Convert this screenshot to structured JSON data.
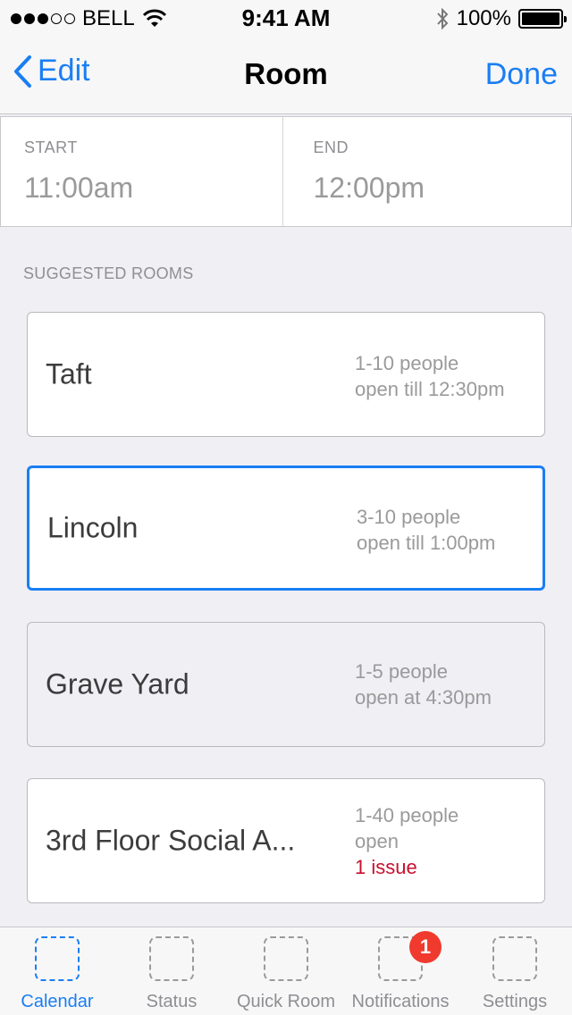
{
  "status_bar": {
    "carrier": "BELL",
    "time": "9:41 AM",
    "battery": "100%",
    "signal_bars_filled": 3,
    "signal_bars_total": 5,
    "icons": [
      "signal-dots-icon",
      "wifi-icon",
      "bluetooth-icon",
      "battery-icon"
    ]
  },
  "nav": {
    "back_label": "Edit",
    "title": "Room",
    "done_label": "Done"
  },
  "time": {
    "start_label": "START",
    "start_value": "11:00am",
    "end_label": "END",
    "end_value": "12:00pm"
  },
  "section_header": "SUGGESTED ROOMS",
  "rooms": [
    {
      "name": "Taft",
      "capacity": "1-10 people",
      "availability": "open till 12:30pm",
      "issue": ""
    },
    {
      "name": "Lincoln",
      "capacity": "3-10 people",
      "availability": "open till 1:00pm",
      "issue": ""
    },
    {
      "name": "Grave Yard",
      "capacity": "1-5 people",
      "availability": "open at 4:30pm",
      "issue": ""
    },
    {
      "name": "3rd Floor Social A...",
      "capacity": "1-40 people",
      "availability": "open",
      "issue": "1 issue"
    }
  ],
  "tabs": [
    {
      "label": "Calendar"
    },
    {
      "label": "Status"
    },
    {
      "label": "Quick Room"
    },
    {
      "label": "Notifications",
      "badge": "1"
    },
    {
      "label": "Settings"
    }
  ],
  "colors": {
    "accent": "#1a7ef3",
    "issue": "#c8102e",
    "badge": "#f03a2e"
  }
}
